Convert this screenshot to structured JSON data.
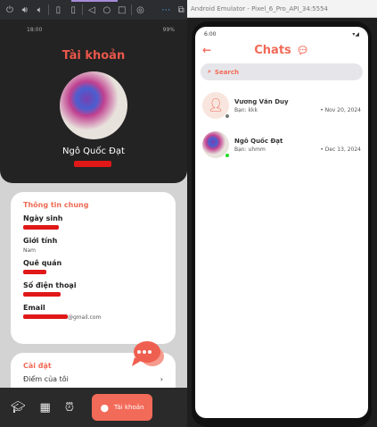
{
  "toolbar": {
    "icons": [
      "power-icon",
      "volume-up-icon",
      "volume-down-icon",
      "rotate-left-icon",
      "rotate-right-icon",
      "back-icon",
      "home-icon",
      "overview-icon",
      "camera-icon",
      "more-icon",
      "zoom-icon"
    ]
  },
  "left_app": {
    "status_time": "18:00",
    "status_battery": "99%",
    "title": "Tài khoản",
    "user_name": "Ngô Quốc Đạt",
    "general_section": "Thông tin chung",
    "fields": [
      {
        "label": "Ngày sinh",
        "value": ""
      },
      {
        "label": "Giới tính",
        "value": "Nam"
      },
      {
        "label": "Quê quán",
        "value": ""
      },
      {
        "label": "Số điện thoại",
        "value": ""
      },
      {
        "label": "Email",
        "value": "@gmail.com"
      }
    ],
    "settings_section": "Cài đặt",
    "settings_item": "Điểm của tôi",
    "nav": {
      "active_label": "Tài khoản"
    }
  },
  "window_title": "Android Emulator - Pixel_6_Pro_API_34:5554",
  "chats_app": {
    "status_time": "6:00",
    "title": "Chats",
    "search_placeholder": "Search",
    "chats": [
      {
        "name": "Vương Văn Duy",
        "message": "Bạn: kkk",
        "date": "• Nov 20, 2024",
        "online": false
      },
      {
        "name": "Ngô Quốc Đạt",
        "message": "Bạn: uhmm",
        "date": "• Dec 13, 2024",
        "online": true
      }
    ]
  },
  "colors": {
    "accent": "#f26a58",
    "online": "#22dd22",
    "offline": "#777777"
  }
}
